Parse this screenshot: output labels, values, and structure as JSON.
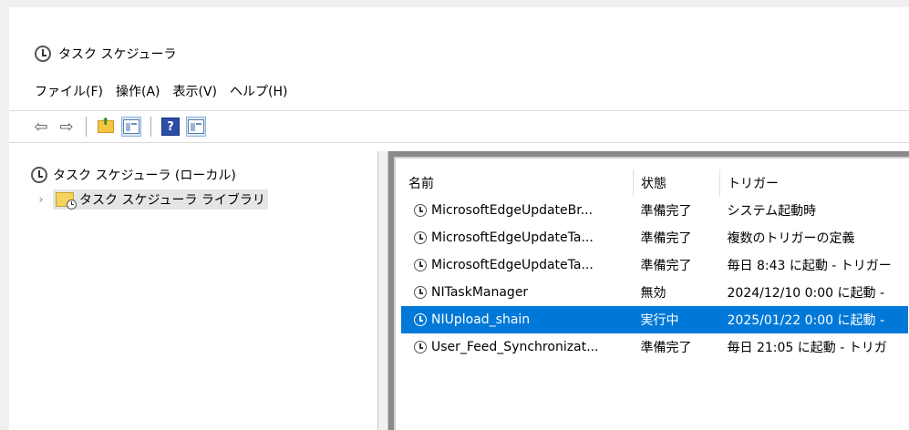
{
  "window": {
    "title": "タスク スケジューラ"
  },
  "menu": [
    "ファイル(F)",
    "操作(A)",
    "表示(V)",
    "ヘルプ(H)"
  ],
  "toolbar": {
    "buttons": [
      "back-arrow-icon",
      "forward-arrow-icon",
      "folder-up-icon",
      "show-hide-pane-icon",
      "help-icon",
      "action-pane-icon"
    ],
    "help_glyph": "?"
  },
  "tree": {
    "root": "タスク スケジューラ (ローカル)",
    "library": "タスク スケジューラ ライブラリ",
    "expander": "›"
  },
  "table": {
    "headers": {
      "name": "名前",
      "status": "状態",
      "trigger": "トリガー"
    },
    "rows": [
      {
        "name": "MicrosoftEdgeUpdateBr...",
        "status": "準備完了",
        "trigger": "システム起動時"
      },
      {
        "name": "MicrosoftEdgeUpdateTa...",
        "status": "準備完了",
        "trigger": "複数のトリガーの定義"
      },
      {
        "name": "MicrosoftEdgeUpdateTa...",
        "status": "準備完了",
        "trigger": "毎日 8:43 に起動 - トリガー"
      },
      {
        "name": "NITaskManager",
        "status": "無効",
        "trigger": "2024/12/10 0:00 に起動 -"
      },
      {
        "name": "NIUpload_shain",
        "status": "実行中",
        "trigger": "2025/01/22 0:00 に起動 -"
      },
      {
        "name": "User_Feed_Synchronizat...",
        "status": "準備完了",
        "trigger": "毎日 21:05 に起動 - トリガ"
      }
    ]
  },
  "colors": {
    "selection": "#0078d7",
    "background": "#ffffff",
    "chrome": "#f0f0f0"
  }
}
